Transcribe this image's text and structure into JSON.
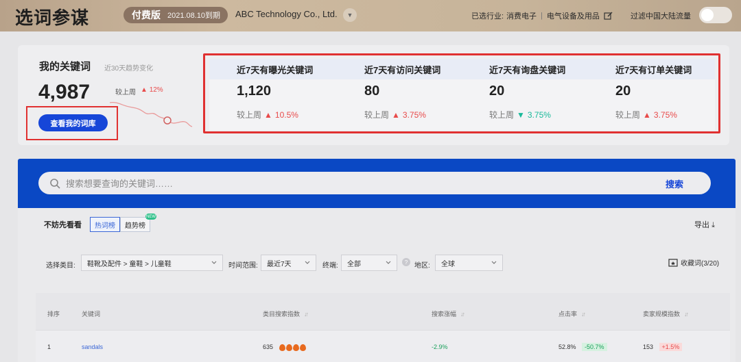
{
  "header": {
    "app_title": "选词参谋",
    "plan_label": "付费版",
    "plan_expiry": "2021.08.10到期",
    "company": "ABC Technology Co., Ltd.",
    "industry_label": "已选行业:",
    "industry_1": "消费电子",
    "industry_sep": "|",
    "industry_2": "电气设备及用品",
    "filter_label": "过滤中国大陆流量"
  },
  "summary": {
    "title": "我的关键词",
    "trend_label": "近30天趋势变化",
    "count": "4,987",
    "last_week_label": "较上周",
    "last_week_change": "12%",
    "last_week_dir": "up",
    "view_library_button": "查看我的词库"
  },
  "stats": [
    {
      "title": "近7天有曝光关键词",
      "value": "1,120",
      "cmp_label": "较上周",
      "change": "10.5%",
      "dir": "up"
    },
    {
      "title": "近7天有访问关键词",
      "value": "80",
      "cmp_label": "较上周",
      "change": "3.75%",
      "dir": "up"
    },
    {
      "title": "近7天有询盘关键词",
      "value": "20",
      "cmp_label": "较上周",
      "change": "3.75%",
      "dir": "down"
    },
    {
      "title": "近7天有订单关键词",
      "value": "20",
      "cmp_label": "较上周",
      "change": "3.75%",
      "dir": "up"
    }
  ],
  "search": {
    "placeholder": "搜索想要查询的关键词……",
    "button": "搜索"
  },
  "board": {
    "peek_label": "不妨先看看",
    "tab_hot": "热词榜",
    "tab_trend": "趋势榜",
    "new_badge": "NEW",
    "export": "导出"
  },
  "filters": {
    "category_label": "选择类目:",
    "category_value": "鞋靴及配件 > 童鞋 > 儿童鞋",
    "time_label": "时间范围:",
    "time_value": "最近7天",
    "terminal_label": "终端:",
    "terminal_value": "全部",
    "region_label": "地区:",
    "region_value": "全球",
    "favorites": "收藏词(3/20)"
  },
  "table": {
    "headers": [
      "排序",
      "关键词",
      "类目搜索指数",
      "搜索涨幅",
      "点击率",
      "卖家规模指数"
    ],
    "rows": [
      {
        "rank": "1",
        "keyword": "sandals",
        "search_index": "635",
        "growth": "-2.9%",
        "ctr": "52.8%",
        "ctr_change": "-50.7%",
        "seller_index": "153",
        "seller_change": "+1.5%"
      }
    ]
  },
  "colors": {
    "accent_blue": "#1646d8",
    "up_red": "#e84a4a",
    "down_teal": "#19b99a",
    "highlight_red": "#e03030"
  }
}
